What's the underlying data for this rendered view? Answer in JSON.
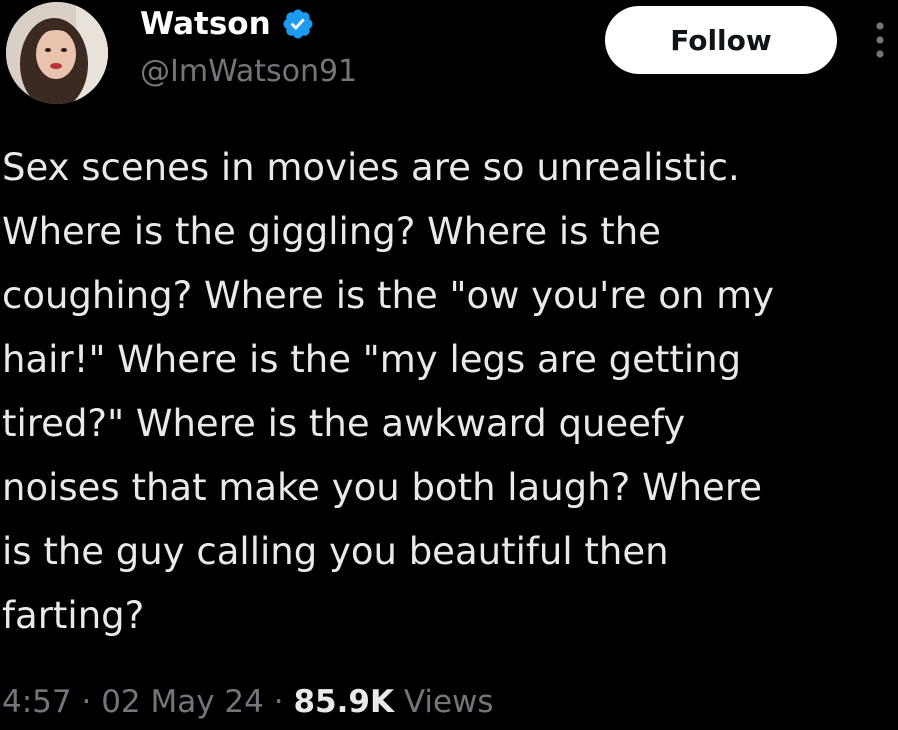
{
  "user": {
    "display_name": "Watson",
    "handle": "@ImWatson91",
    "verified_color": "#1d9bf0"
  },
  "actions": {
    "follow_label": "Follow",
    "more_icon": "more-vertical-icon"
  },
  "tweet": {
    "lines": [
      "Sex scenes in movies are so unrealistic.",
      "Where is the giggling? Where is the",
      "coughing? Where is the \"ow you're on my",
      "hair!\" Where is the \"my legs are getting",
      "tired?\" Where is the awkward queefy",
      "noises that make you both laugh? Where",
      "is the guy calling you beautiful then",
      "farting?"
    ]
  },
  "meta": {
    "time": "4:57",
    "separator": " · ",
    "date": "02 May 24",
    "views_count": "85.9K",
    "views_label": " Views"
  },
  "colors": {
    "background": "#000000",
    "text": "#e7e9ea",
    "secondary_text": "#71767b",
    "button_bg": "#ffffff"
  }
}
